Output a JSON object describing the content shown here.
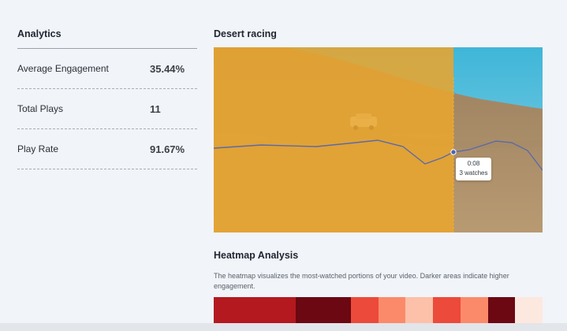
{
  "analytics": {
    "title": "Analytics",
    "metrics": [
      {
        "label": "Average Engagement",
        "value": "35.44%"
      },
      {
        "label": "Total Plays",
        "value": "11"
      },
      {
        "label": "Play Rate",
        "value": "91.67%"
      }
    ]
  },
  "video": {
    "title": "Desert racing",
    "playhead_position": 0.73,
    "tooltip": {
      "time": "0:08",
      "watches": "3 watches"
    },
    "colors": {
      "overlay": "#e8a52f",
      "line": "#5a6aa8",
      "playhead": "#f0b030"
    }
  },
  "heatmap": {
    "title": "Heatmap Analysis",
    "description": "The heatmap visualizes the most-watched portions of your video. Darker areas indicate higher engagement.",
    "cells": [
      "#b3191f",
      "#b3191f",
      "#b3191f",
      "#6b0812",
      "#6b0812",
      "#ec4a3a",
      "#fb8a6a",
      "#fcc1a8",
      "#ec4a3a",
      "#fb8a6a",
      "#6b0812",
      "#fde8e0"
    ]
  }
}
